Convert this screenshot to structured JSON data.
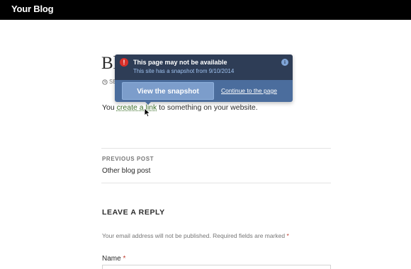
{
  "header": {
    "site_title": "Your Blog"
  },
  "post": {
    "title_visible": "Bl",
    "meta_visible": "SE",
    "body_prefix": "You ",
    "body_link": "create a link",
    "body_suffix": " to something on your website."
  },
  "navigation": {
    "previous_label": "PREVIOUS POST",
    "previous_title": "Other blog post"
  },
  "reply": {
    "title": "LEAVE A REPLY",
    "note": "Your email address will not be published. Required fields are marked",
    "required_mark": "*",
    "name_label": "Name",
    "name_required": "*"
  },
  "popover": {
    "title": "This page may not be available",
    "subtitle": "This site has a snapshot from 9/10/2014",
    "snapshot_button": "View the snapshot",
    "continue_link": "Continue to the page",
    "warning_glyph": "!",
    "info_glyph": "i",
    "icons": [
      "warning-icon",
      "info-icon"
    ]
  },
  "colors": {
    "topbar": "#000000",
    "popover_header": "#2e3d56",
    "popover_footer": "#4b6d9d",
    "link_green": "#3d6f2a",
    "required_red": "#c0392b"
  }
}
